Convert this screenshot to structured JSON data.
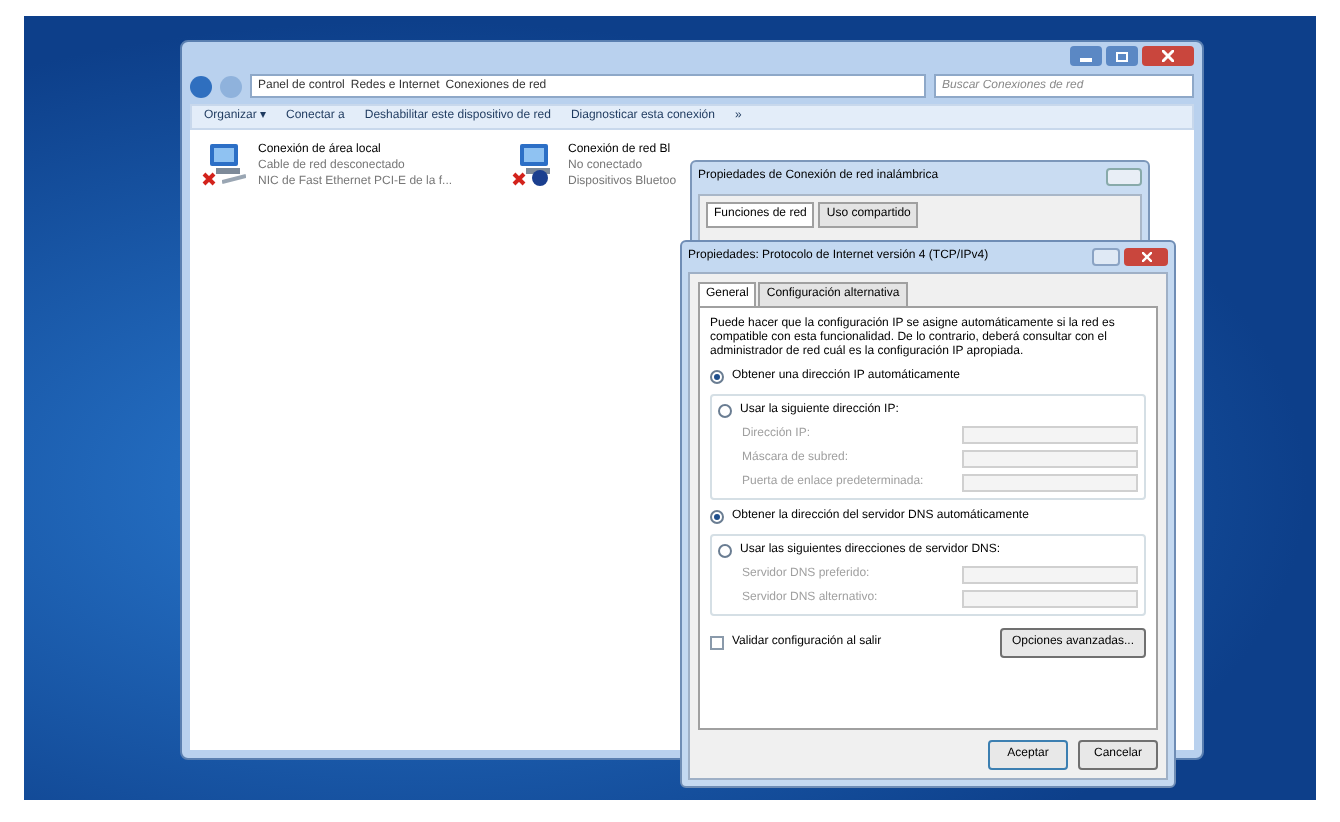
{
  "explorer": {
    "breadcrumb": [
      "Panel de control",
      "Redes e Internet",
      "Conexiones de red"
    ],
    "search": {
      "placeholder": "Buscar Conexiones de red"
    },
    "toolbar": [
      "Organizar ▾",
      "Conectar a",
      "Deshabilitar este dispositivo de red",
      "Diagnosticar esta conexión",
      "»"
    ],
    "connections": [
      {
        "kind": "ethernet",
        "name": "Conexión de área local",
        "status": "Cable de red desconectado",
        "device": "NIC de Fast Ethernet PCI-E de la f...",
        "disconnected": true
      },
      {
        "kind": "bluetooth",
        "name": "Conexión de red Bl",
        "status": "No conectado",
        "device": "Dispositivos Bluetoo",
        "disconnected": true
      }
    ]
  },
  "back_dialog": {
    "title": "Propiedades de Conexión de red inalámbrica",
    "tabs": [
      {
        "label": "Funciones de red",
        "selected": true
      },
      {
        "label": "Uso compartido",
        "selected": false
      }
    ]
  },
  "ipv4_dialog": {
    "title": "Propiedades: Protocolo de Internet versión 4 (TCP/IPv4)",
    "tabs": [
      {
        "label": "General",
        "selected": true
      },
      {
        "label": "Configuración alternativa",
        "selected": false
      }
    ],
    "description": "Puede hacer que la configuración IP se asigne automáticamente si la red es compatible con esta funcionalidad. De lo contrario, deberá consultar con el administrador de red cuál es la configuración IP apropiada.",
    "ip_options": [
      {
        "label": "Obtener una dirección IP automáticamente",
        "selected": true
      },
      {
        "label": "Usar la siguiente dirección IP:",
        "selected": false
      }
    ],
    "ip_fields": [
      {
        "label": "Dirección IP:",
        "disabled": true
      },
      {
        "label": "Máscara de subred:",
        "disabled": true
      },
      {
        "label": "Puerta de enlace predeterminada:",
        "disabled": true
      }
    ],
    "dns_options": [
      {
        "label": "Obtener la dirección del servidor DNS automáticamente",
        "selected": true
      },
      {
        "label": "Usar las siguientes direcciones de servidor DNS:",
        "selected": false
      }
    ],
    "dns_fields": [
      {
        "label": "Servidor DNS preferido:",
        "disabled": true
      },
      {
        "label": "Servidor DNS alternativo:",
        "disabled": true
      }
    ],
    "validate": {
      "label": "Validar configuración al salir",
      "checked": false
    },
    "advanced_button": "Opciones avanzadas...",
    "buttons": [
      "Aceptar",
      "Cancelar"
    ]
  }
}
